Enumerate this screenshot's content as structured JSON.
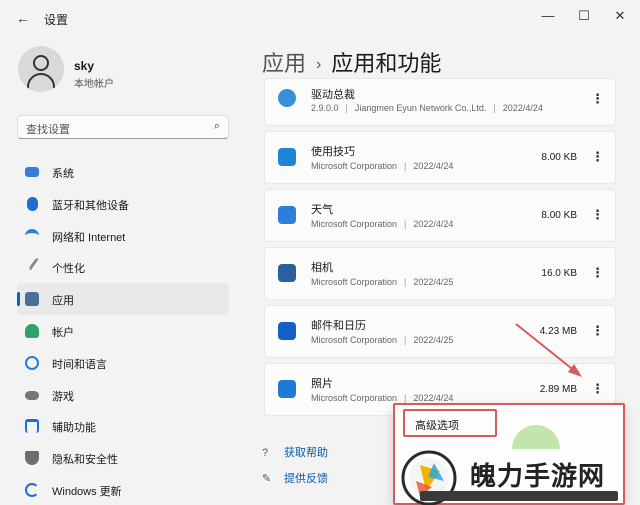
{
  "window": {
    "back_glyph": "←",
    "title": "设置",
    "controls": [
      "—",
      "☐",
      "✕"
    ]
  },
  "user": {
    "name": "sky",
    "account_type": "本地帐户"
  },
  "search": {
    "placeholder": "查找设置",
    "icon": "search-icon"
  },
  "sidebar": {
    "items": [
      {
        "label": "系统",
        "icon": "monitor-icon",
        "color": "#3a7bd5"
      },
      {
        "label": "蓝牙和其他设备",
        "icon": "bluetooth-icon",
        "color": "#1c6fd0"
      },
      {
        "label": "网络和 Internet",
        "icon": "wifi-icon",
        "color": "#2a7fd4"
      },
      {
        "label": "个性化",
        "icon": "brush-icon",
        "color": "#8a8a8a"
      },
      {
        "label": "应用",
        "icon": "apps-icon",
        "color": "#4a6f9a",
        "active": true
      },
      {
        "label": "帐户",
        "icon": "account-icon",
        "color": "#2fa36b"
      },
      {
        "label": "时间和语言",
        "icon": "clock-globe-icon",
        "color": "#2a7fd4"
      },
      {
        "label": "游戏",
        "icon": "gamepad-icon",
        "color": "#777777"
      },
      {
        "label": "辅助功能",
        "icon": "accessibility-icon",
        "color": "#1c6fd0"
      },
      {
        "label": "隐私和安全性",
        "icon": "shield-icon",
        "color": "#6e6e6e"
      },
      {
        "label": "Windows 更新",
        "icon": "update-icon",
        "color": "#1c6fd0"
      }
    ]
  },
  "breadcrumb": {
    "parent": "应用",
    "separator": "›",
    "current": "应用和功能"
  },
  "apps": [
    {
      "name": "驱动总裁",
      "version": "2.9.0.0",
      "publisher": "Jiangmen Eyun Network Co.,Ltd.",
      "date": "2022/4/24",
      "size": "",
      "icon": "driver-icon",
      "color": "#3a8fd8"
    },
    {
      "name": "使用技巧",
      "version": "",
      "publisher": "Microsoft Corporation",
      "date": "2022/4/24",
      "size": "8.00 KB",
      "icon": "lightbulb-icon",
      "color": "#1f86d6"
    },
    {
      "name": "天气",
      "version": "",
      "publisher": "Microsoft Corporation",
      "date": "2022/4/24",
      "size": "8.00 KB",
      "icon": "weather-icon",
      "color": "#2c7ed8"
    },
    {
      "name": "相机",
      "version": "",
      "publisher": "Microsoft Corporation",
      "date": "2022/4/25",
      "size": "16.0 KB",
      "icon": "camera-icon",
      "color": "#2c5f9e"
    },
    {
      "name": "邮件和日历",
      "version": "",
      "publisher": "Microsoft Corporation",
      "date": "2022/4/25",
      "size": "4.23 MB",
      "icon": "mail-icon",
      "color": "#1560c7"
    },
    {
      "name": "照片",
      "version": "",
      "publisher": "Microsoft Corporation",
      "date": "2022/4/24",
      "size": "2.89 MB",
      "icon": "photos-icon",
      "color": "#1f7ad6"
    }
  ],
  "more_glyph": "⋮",
  "context_menu": {
    "items": [
      "高级选项"
    ]
  },
  "links": {
    "help": "获取帮助",
    "feedback": "提供反馈"
  },
  "watermark": {
    "text": "魄力手游网"
  },
  "colors": {
    "accent": "#0067c0",
    "annotation": "#d85a5a"
  }
}
